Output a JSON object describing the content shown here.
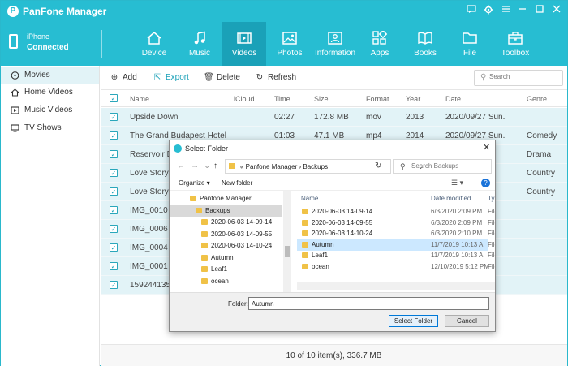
{
  "app": {
    "title": "PanFone Manager",
    "logo_glyph": "P",
    "accent": "#27bdd2"
  },
  "window_controls": [
    "feedback-icon",
    "gear-icon",
    "menu-icon",
    "minimize-icon",
    "maximize-icon",
    "close-icon"
  ],
  "device": {
    "name": "iPhone",
    "status": "Connected"
  },
  "nav": {
    "tabs": [
      {
        "label": "Device",
        "icon": "home-icon"
      },
      {
        "label": "Music",
        "icon": "music-note-icon"
      },
      {
        "label": "Videos",
        "icon": "film-icon",
        "active": true
      },
      {
        "label": "Photos",
        "icon": "image-icon"
      },
      {
        "label": "Information",
        "icon": "contact-card-icon"
      },
      {
        "label": "Apps",
        "icon": "apps-grid-icon"
      },
      {
        "label": "Books",
        "icon": "book-icon"
      },
      {
        "label": "File",
        "icon": "folder-icon"
      },
      {
        "label": "Toolbox",
        "icon": "toolbox-icon"
      }
    ]
  },
  "sidebar": {
    "items": [
      {
        "label": "Movies",
        "icon": "movie-disc-icon",
        "active": true
      },
      {
        "label": "Home Videos",
        "icon": "home-video-icon"
      },
      {
        "label": "Music Videos",
        "icon": "music-video-icon"
      },
      {
        "label": "TV Shows",
        "icon": "tv-icon"
      }
    ]
  },
  "toolbar": {
    "add": "Add",
    "export": "Export",
    "delete": "Delete",
    "refresh": "Refresh"
  },
  "search": {
    "placeholder": "Search"
  },
  "table": {
    "columns": [
      "Name",
      "iCloud",
      "Time",
      "Size",
      "Format",
      "Year",
      "Date",
      "Genre"
    ],
    "rows": [
      {
        "name": "Upside Down",
        "icloud": "",
        "time": "02:27",
        "size": "172.8 MB",
        "format": "mov",
        "year": "2013",
        "date": "2020/09/27 Sun.",
        "genre": ""
      },
      {
        "name": "The Grand Budapest Hotel",
        "icloud": "",
        "time": "01:03",
        "size": "47.1 MB",
        "format": "mp4",
        "year": "2014",
        "date": "2020/09/27 Sun.",
        "genre": "Comedy"
      },
      {
        "name": "Reservoir D",
        "icloud": "",
        "time": "",
        "size": "",
        "format": "",
        "year": "",
        "date": "",
        "genre": "Drama"
      },
      {
        "name": "Love Story",
        "icloud": "",
        "time": "",
        "size": "",
        "format": "",
        "year": "",
        "date": "",
        "genre": "Country"
      },
      {
        "name": "Love Story",
        "icloud": "",
        "time": "",
        "size": "",
        "format": "",
        "year": "",
        "date": "",
        "genre": "Country"
      },
      {
        "name": "IMG_0010",
        "icloud": "",
        "time": "",
        "size": "",
        "format": "",
        "year": "",
        "date": "",
        "genre": ""
      },
      {
        "name": "IMG_0006",
        "icloud": "",
        "time": "",
        "size": "",
        "format": "",
        "year": "",
        "date": "",
        "genre": ""
      },
      {
        "name": "IMG_0004",
        "icloud": "",
        "time": "",
        "size": "",
        "format": "",
        "year": "",
        "date": "",
        "genre": ""
      },
      {
        "name": "IMG_0001",
        "icloud": "",
        "time": "",
        "size": "",
        "format": "",
        "year": "",
        "date": "",
        "genre": ""
      },
      {
        "name": "159244135",
        "icloud": "",
        "time": "",
        "size": "",
        "format": "",
        "year": "",
        "date": "",
        "genre": ""
      }
    ]
  },
  "footer": {
    "status": "10 of 10 item(s), 336.7 MB"
  },
  "dialog": {
    "title": "Select Folder",
    "path": "«  Panfone Manager  ›  Backups",
    "search_placeholder": "Search Backups",
    "organize": "Organize ▾",
    "new_folder": "New folder",
    "tree": [
      {
        "label": "Panfone Manager",
        "indent": 1
      },
      {
        "label": "Backups",
        "indent": 2,
        "active": true
      },
      {
        "label": "2020-06-03 14-09-14",
        "indent": 3
      },
      {
        "label": "2020-06-03 14-09-55",
        "indent": 3
      },
      {
        "label": "2020-06-03 14-10-24",
        "indent": 3
      },
      {
        "label": "Autumn",
        "indent": 3
      },
      {
        "label": "Leaf1",
        "indent": 3
      },
      {
        "label": "ocean",
        "indent": 3
      }
    ],
    "file_columns": [
      "Name",
      "Date modified",
      "Ty"
    ],
    "files": [
      {
        "name": "2020-06-03 14-09-14",
        "date": "6/3/2020 2:09 PM",
        "type": "File"
      },
      {
        "name": "2020-06-03 14-09-55",
        "date": "6/3/2020 2:09 PM",
        "type": "File"
      },
      {
        "name": "2020-06-03 14-10-24",
        "date": "6/3/2020 2:10 PM",
        "type": "File"
      },
      {
        "name": "Autumn",
        "date": "11/7/2019 10:13 A",
        "type": "File",
        "active": true
      },
      {
        "name": "Leaf1",
        "date": "11/7/2019 10:13 A",
        "type": "File"
      },
      {
        "name": "ocean",
        "date": "12/10/2019 5:12 PM",
        "type": "File"
      }
    ],
    "folder_label": "Folder:",
    "folder_value": "Autumn",
    "select_button": "Select Folder",
    "cancel_button": "Cancel"
  }
}
